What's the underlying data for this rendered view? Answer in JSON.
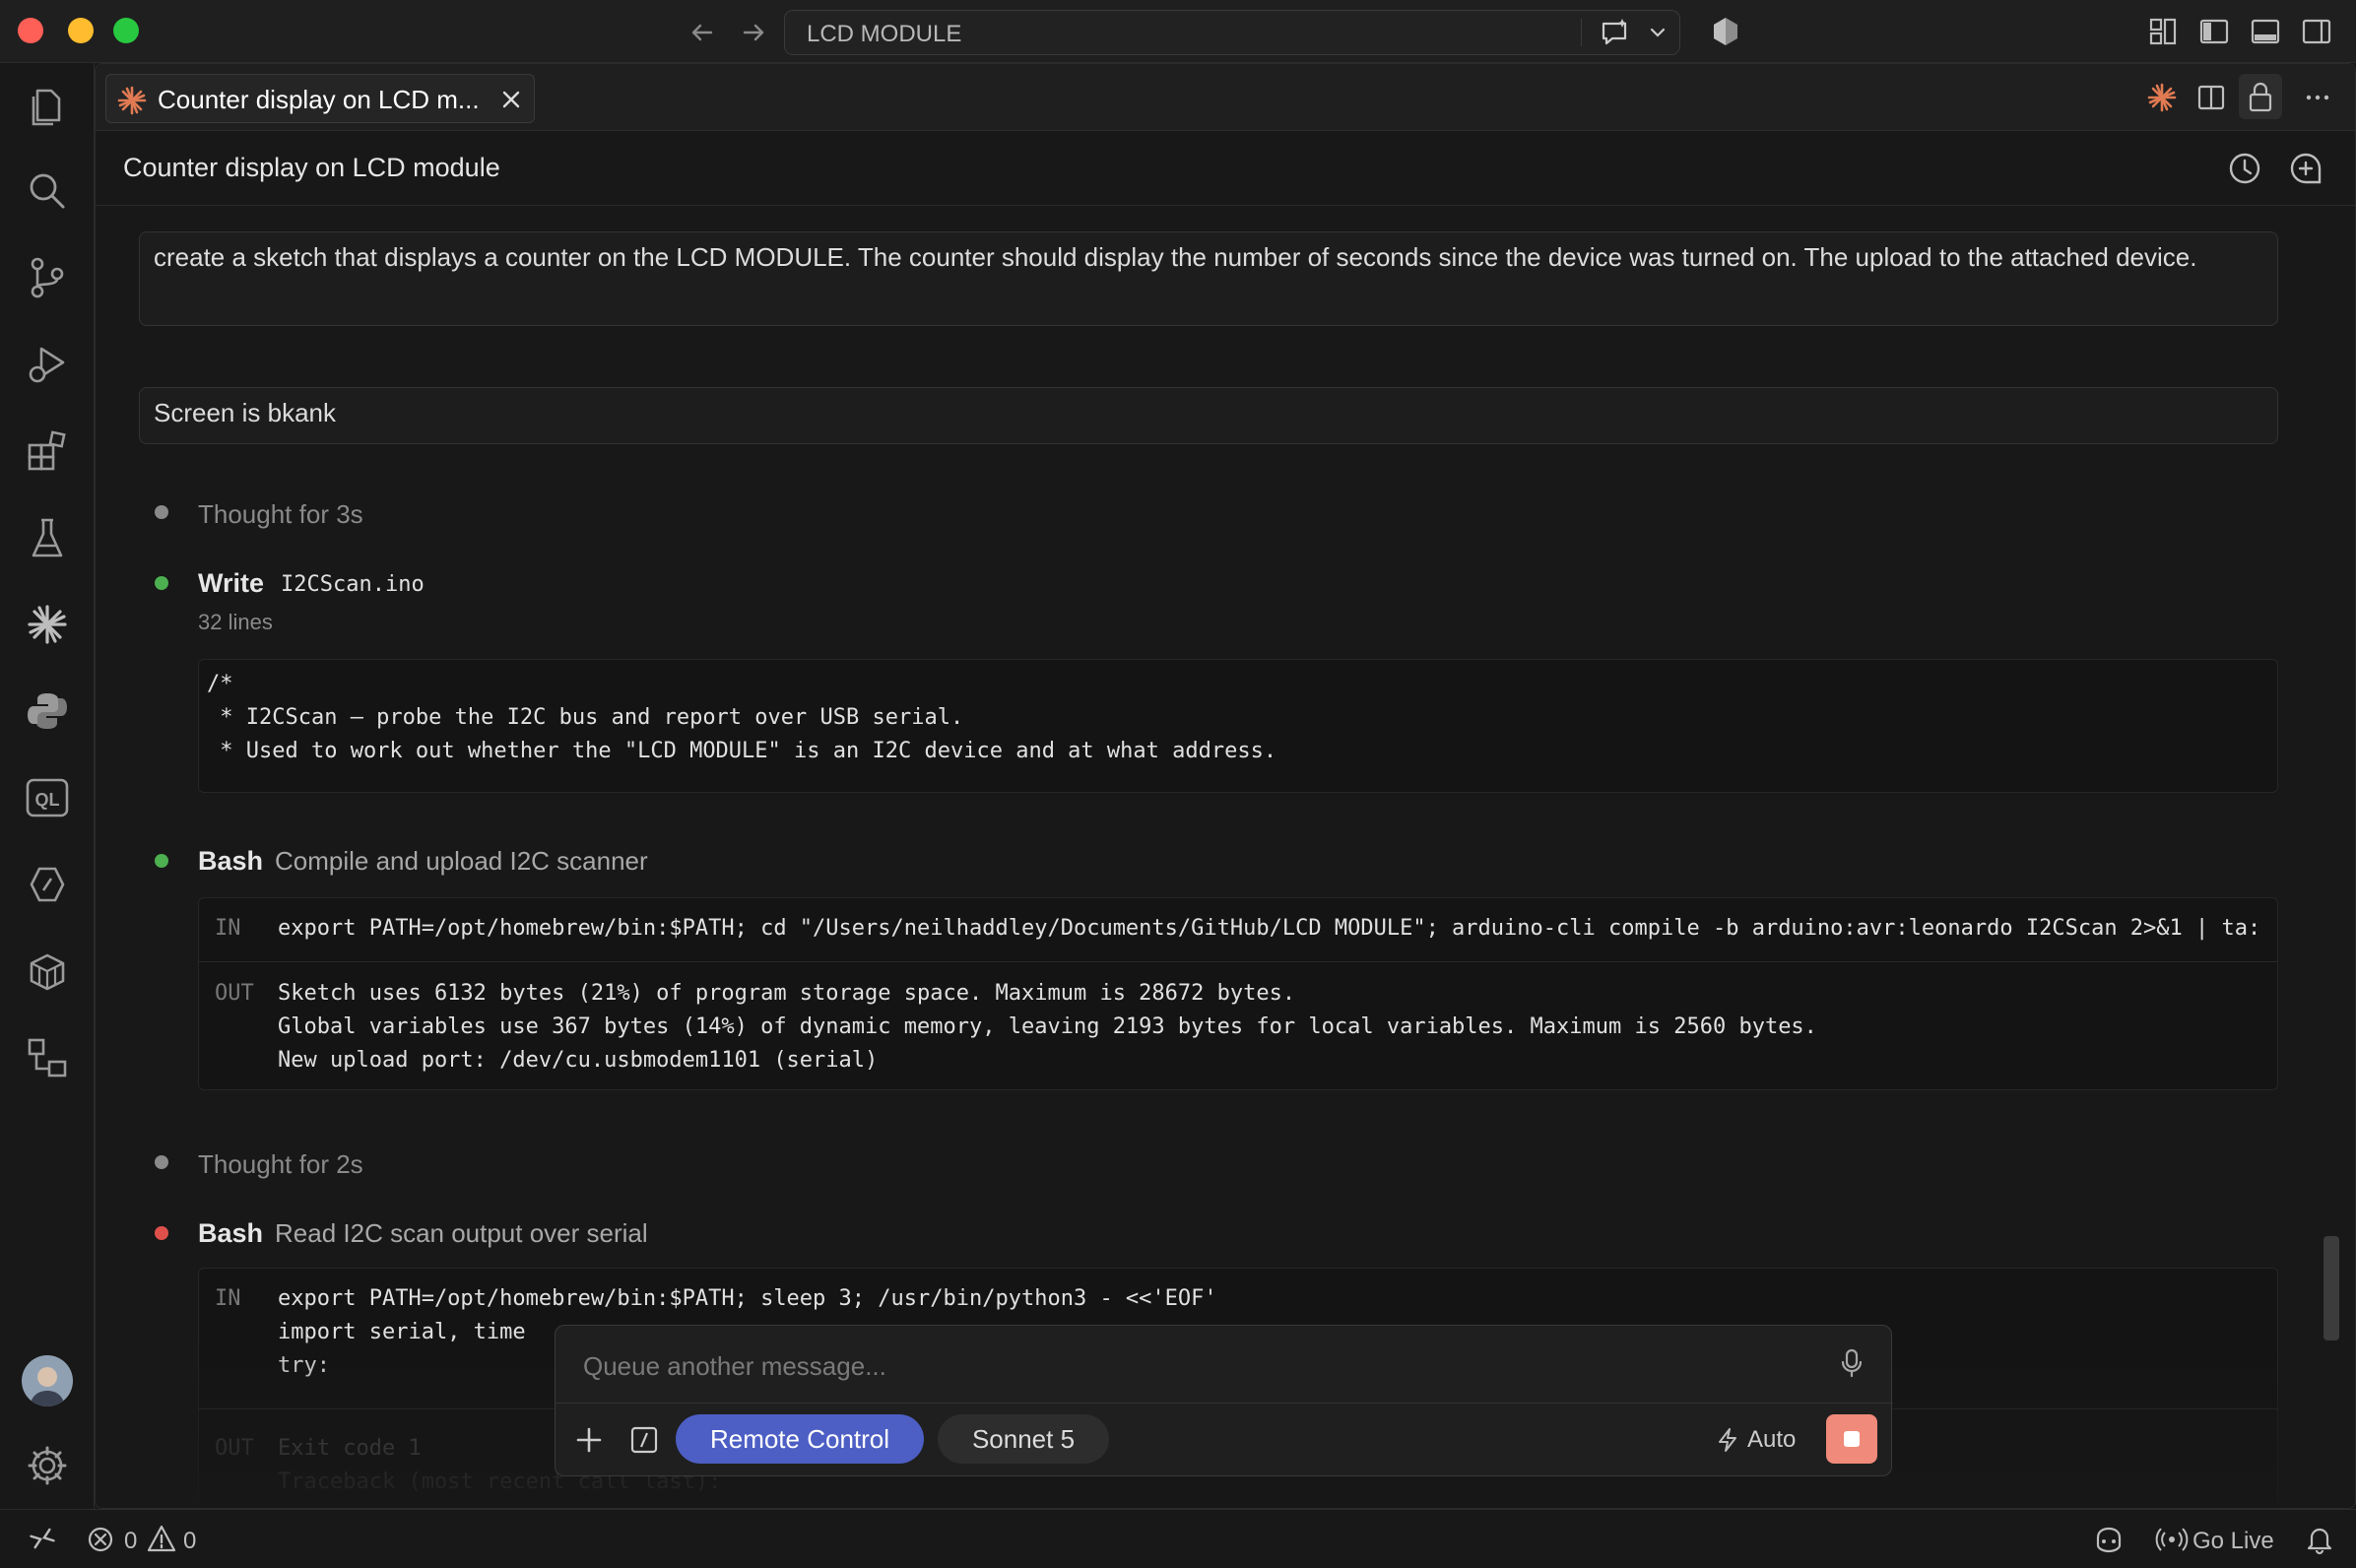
{
  "window": {
    "title": "LCD MODULE"
  },
  "tab": {
    "label": "Counter display on LCD m...",
    "close": "×"
  },
  "panel": {
    "title": "Counter display on LCD module"
  },
  "messages": [
    "create a sketch that displays a counter on the LCD MODULE. The counter should display the number of seconds since the device was turned on. The upload to the attached device.",
    "Screen is bkank"
  ],
  "steps": {
    "thought1": "Thought for 3s",
    "write": {
      "verb": "Write",
      "file": "I2CScan.ino",
      "meta": "32 lines",
      "code": [
        "/*",
        " * I2CScan — probe the I2C bus and report over USB serial.",
        " * Used to work out whether the \"LCD MODULE\" is an I2C device and at what address."
      ]
    },
    "bash1": {
      "verb": "Bash",
      "desc": "Compile and upload I2C scanner",
      "in_label": "IN",
      "in": "export PATH=/opt/homebrew/bin:$PATH; cd \"/Users/neilhaddley/Documents/GitHub/LCD MODULE\"; arduino-cli compile -b arduino:avr:leonardo I2CScan 2>&1 | ta:",
      "out_label": "OUT",
      "out": [
        "Sketch uses 6132 bytes (21%) of program storage space. Maximum is 28672 bytes.",
        "Global variables use 367 bytes (14%) of dynamic memory, leaving 2193 bytes for local variables. Maximum is 2560 bytes.",
        "New upload port: /dev/cu.usbmodem1101 (serial)"
      ]
    },
    "thought2": "Thought for 2s",
    "bash2": {
      "verb": "Bash",
      "desc": "Read I2C scan output over serial",
      "in_label": "IN",
      "in": [
        "export PATH=/opt/homebrew/bin:$PATH; sleep 3; /usr/bin/python3 - <<'EOF'",
        "import serial, time",
        "try:"
      ],
      "out_label": "OUT",
      "out": [
        "Exit code 1",
        "Traceback (most recent call last):"
      ]
    }
  },
  "composer": {
    "placeholder": "Queue another message...",
    "remote": "Remote Control",
    "model": "Sonnet 5",
    "mode": "Auto"
  },
  "status": {
    "errors": "0",
    "warnings": "0",
    "golive": "Go Live"
  },
  "colors": {
    "accent": "#4d5fc4",
    "claude": "#e07a52",
    "stop": "#f08a7a",
    "dot_green": "#4caf50",
    "dot_red": "#e0504b",
    "dot_gray": "#8a8a8a"
  }
}
